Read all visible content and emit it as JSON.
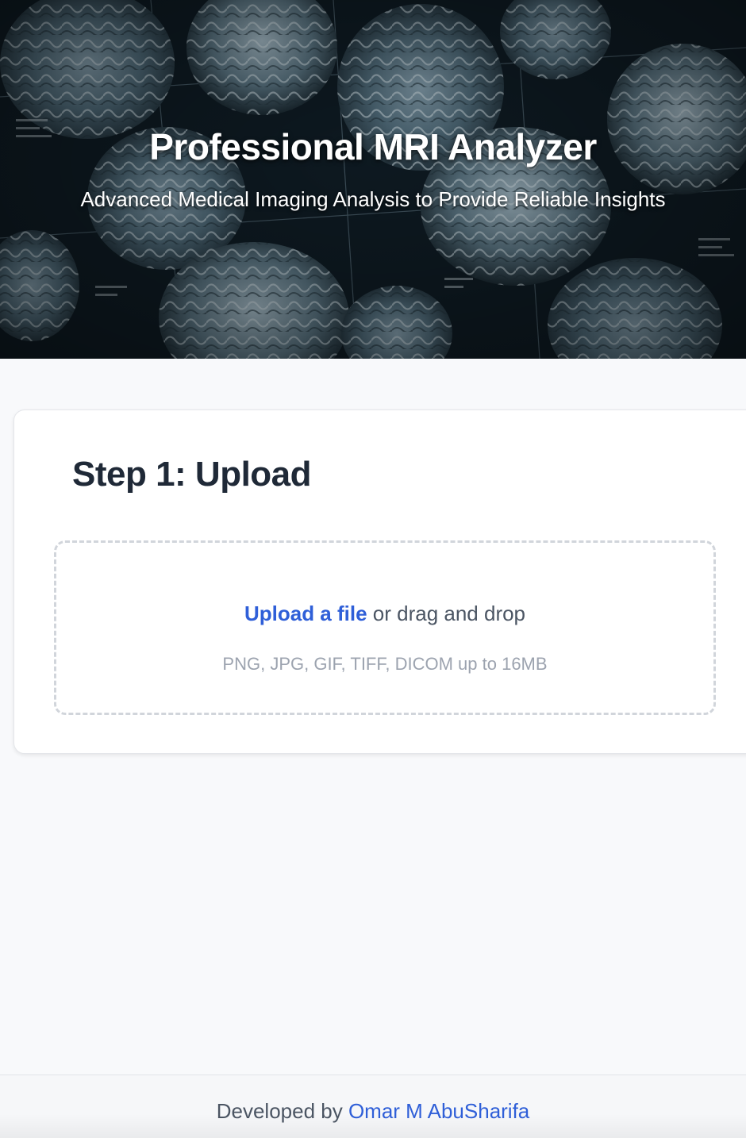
{
  "hero": {
    "title": "Professional MRI Analyzer",
    "subtitle": "Advanced Medical Imaging Analysis to Provide Reliable Insights",
    "background_image": "mri-brain-scans-collage"
  },
  "upload": {
    "step_title": "Step 1: Upload",
    "link_label": "Upload a file",
    "drag_text": " or drag and drop",
    "hint": "PNG, JPG, GIF, TIFF, DICOM up to 16MB"
  },
  "footer": {
    "prefix": "Developed by ",
    "author": "Omar M AbuSharifa"
  },
  "colors": {
    "accent": "#2f5fd8",
    "heading": "#1f2937",
    "page_background": "#f8f9fb"
  }
}
